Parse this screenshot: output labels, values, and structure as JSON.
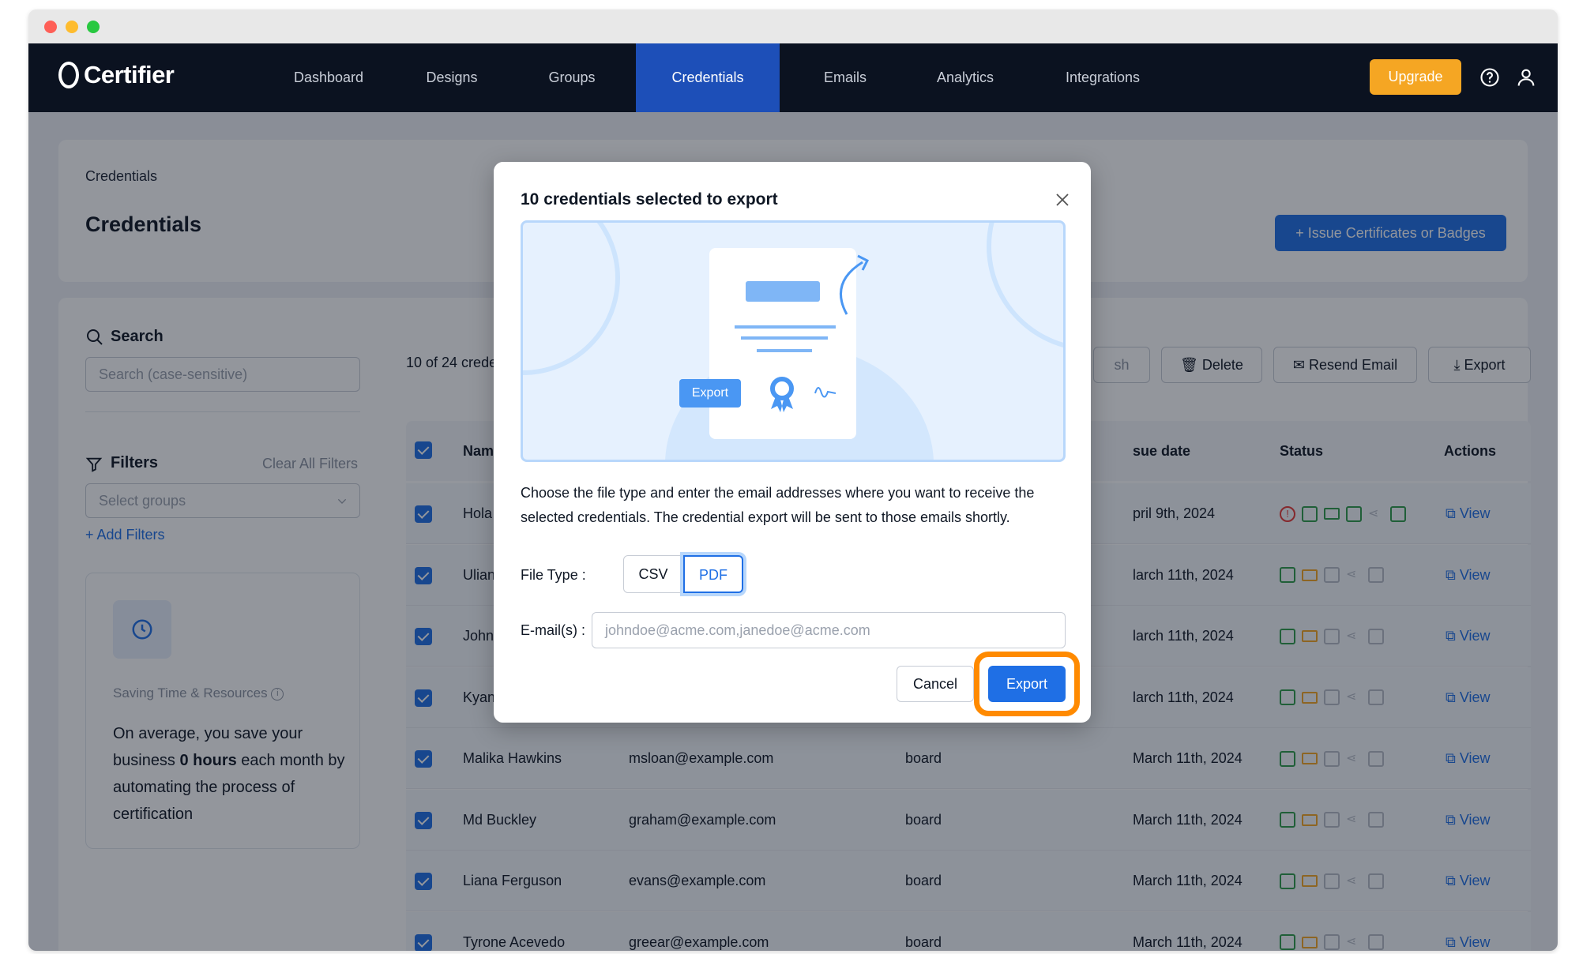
{
  "app": {
    "logo_text": "Certifier",
    "nav": [
      "Dashboard",
      "Designs",
      "Groups",
      "Credentials",
      "Emails",
      "Analytics",
      "Integrations"
    ],
    "active_nav": "Credentials",
    "upgrade_label": "Upgrade"
  },
  "page": {
    "breadcrumb": "Credentials",
    "title": "Credentials",
    "issue_button": "+  Issue Certificates or Badges"
  },
  "sidebar": {
    "search_label": "Search",
    "search_placeholder": "Search (case-sensitive)",
    "filters_label": "Filters",
    "clear_filters": "Clear All Filters",
    "groups_placeholder": "Select groups",
    "add_filters": "+  Add Filters",
    "saving_title": "Saving Time & Resources",
    "saving_text_pre": "On average, you save your business ",
    "saving_hours": "0 hours",
    "saving_text_post": " each month by automating the process of certification"
  },
  "toolbar": {
    "count_text": "10 of 24 crede",
    "hidden_btn": "sh",
    "delete_label": "Delete",
    "resend_label": "Resend Email",
    "export_label": "Export"
  },
  "table": {
    "headers": {
      "name": "Nam",
      "issue_date": "sue date",
      "status": "Status",
      "actions": "Actions"
    },
    "rows": [
      {
        "name": "Hola",
        "email": "",
        "group": "",
        "date": "pril 9th, 2024",
        "view": "View"
      },
      {
        "name": "Ulian",
        "email": "",
        "group": "",
        "date": "larch 11th, 2024",
        "view": "View"
      },
      {
        "name": "John",
        "email": "",
        "group": "",
        "date": "larch 11th, 2024",
        "view": "View"
      },
      {
        "name": "Kyan",
        "email": "",
        "group": "",
        "date": "larch 11th, 2024",
        "view": "View"
      },
      {
        "name": "Malika Hawkins",
        "email": "msloan@example.com",
        "group": "board",
        "date": "March 11th, 2024",
        "view": "View"
      },
      {
        "name": "Md Buckley",
        "email": "graham@example.com",
        "group": "board",
        "date": "March 11th, 2024",
        "view": "View"
      },
      {
        "name": "Liana Ferguson",
        "email": "evans@example.com",
        "group": "board",
        "date": "March 11th, 2024",
        "view": "View"
      },
      {
        "name": "Tyrone Acevedo",
        "email": "greear@example.com",
        "group": "board",
        "date": "March 11th, 2024",
        "view": "View"
      }
    ]
  },
  "modal": {
    "title": "10 credentials selected to export",
    "illustration_button": "Export",
    "description": "Choose the file type and enter the email addresses where you want to receive the selected credentials. The credential export will be sent to those emails shortly.",
    "file_type_label": "File Type :",
    "file_types": [
      "CSV",
      "PDF"
    ],
    "selected_file_type": "PDF",
    "email_label": "E-mail(s) :",
    "email_placeholder": "johndoe@acme.com,janedoe@acme.com",
    "cancel_label": "Cancel",
    "export_label": "Export"
  },
  "colors": {
    "nav_bg": "#0b1220",
    "accent": "#1f6fe5",
    "upgrade": "#f5a623",
    "highlight_ring": "#ff8a00"
  }
}
